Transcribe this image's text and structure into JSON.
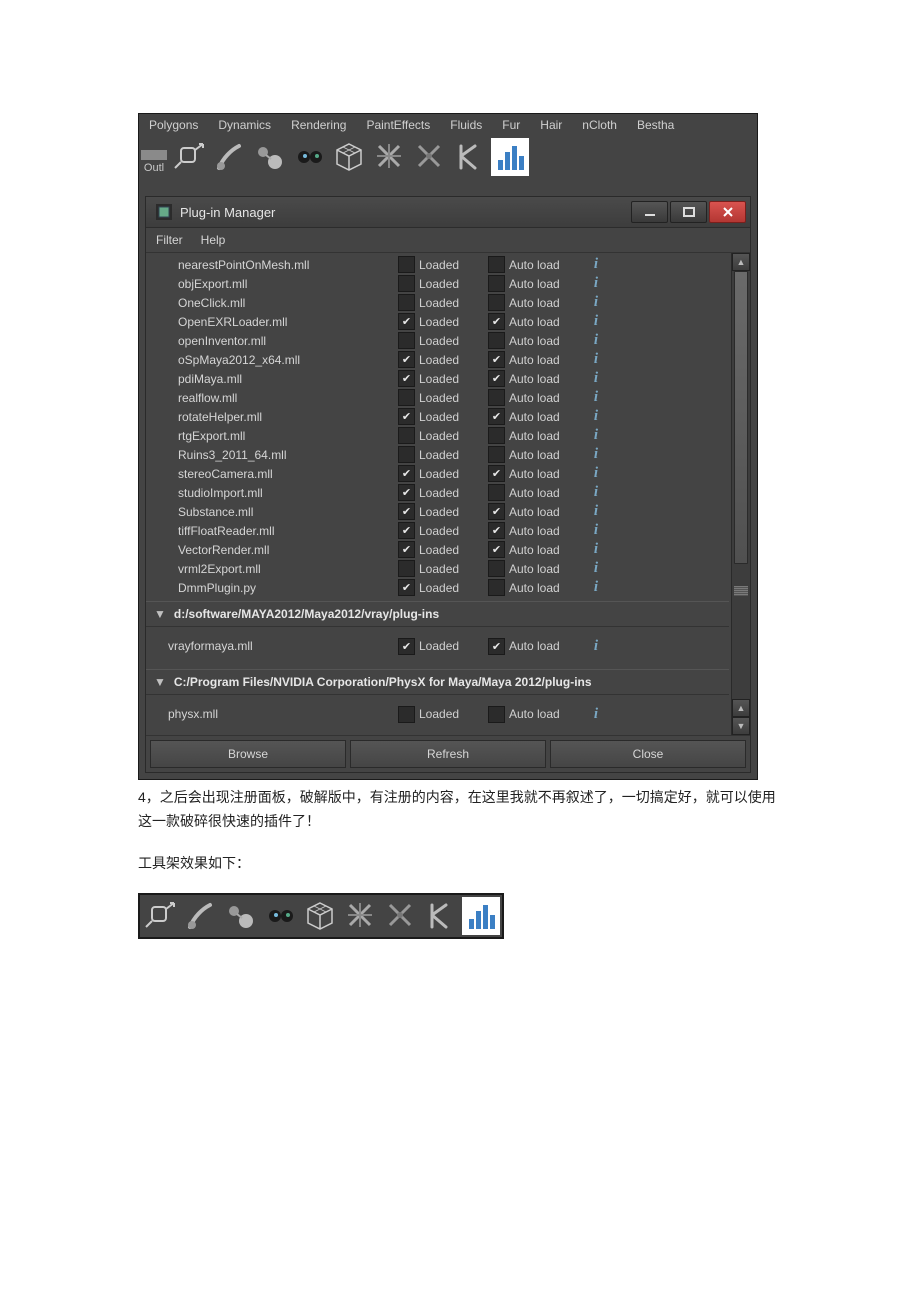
{
  "shelf_tabs": [
    "Polygons",
    "Dynamics",
    "Rendering",
    "PaintEffects",
    "Fluids",
    "Fur",
    "Hair",
    "nCloth",
    "Bestha"
  ],
  "outliner_label": "Outl",
  "window": {
    "title": "Plug-in Manager",
    "menu": {
      "filter": "Filter",
      "help": "Help"
    },
    "labels": {
      "loaded": "Loaded",
      "autoload": "Auto load"
    },
    "sections": [
      {
        "header": null,
        "plugins": [
          {
            "name": "nearestPointOnMesh.mll",
            "loaded": false,
            "autoload": false
          },
          {
            "name": "objExport.mll",
            "loaded": false,
            "autoload": false
          },
          {
            "name": "OneClick.mll",
            "loaded": false,
            "autoload": false
          },
          {
            "name": "OpenEXRLoader.mll",
            "loaded": true,
            "autoload": true
          },
          {
            "name": "openInventor.mll",
            "loaded": false,
            "autoload": false
          },
          {
            "name": "oSpMaya2012_x64.mll",
            "loaded": true,
            "autoload": true
          },
          {
            "name": "pdiMaya.mll",
            "loaded": true,
            "autoload": true
          },
          {
            "name": "realflow.mll",
            "loaded": false,
            "autoload": false
          },
          {
            "name": "rotateHelper.mll",
            "loaded": true,
            "autoload": true
          },
          {
            "name": "rtgExport.mll",
            "loaded": false,
            "autoload": false
          },
          {
            "name": "Ruins3_2011_64.mll",
            "loaded": false,
            "autoload": false
          },
          {
            "name": "stereoCamera.mll",
            "loaded": true,
            "autoload": true
          },
          {
            "name": "studioImport.mll",
            "loaded": true,
            "autoload": false
          },
          {
            "name": "Substance.mll",
            "loaded": true,
            "autoload": true
          },
          {
            "name": "tiffFloatReader.mll",
            "loaded": true,
            "autoload": true
          },
          {
            "name": "VectorRender.mll",
            "loaded": true,
            "autoload": true
          },
          {
            "name": "vrml2Export.mll",
            "loaded": false,
            "autoload": false
          },
          {
            "name": "DmmPlugin.py",
            "loaded": true,
            "autoload": false
          }
        ]
      },
      {
        "header": "d:/software/MAYA2012/Maya2012/vray/plug-ins",
        "plugins": [
          {
            "name": "vrayformaya.mll",
            "loaded": true,
            "autoload": true
          }
        ]
      },
      {
        "header": "C:/Program Files/NVIDIA Corporation/PhysX for Maya/Maya 2012/plug-ins",
        "plugins": [
          {
            "name": "physx.mll",
            "loaded": false,
            "autoload": false
          }
        ]
      }
    ],
    "buttons": {
      "browse": "Browse",
      "refresh": "Refresh",
      "close": "Close"
    }
  },
  "article": {
    "p1": "4，之后会出现注册面板，破解版中，有注册的内容，在这里我就不再叙述了，一切搞定好，就可以使用这一款破碎很快速的插件了！",
    "p2": "工具架效果如下："
  },
  "icons": {
    "tool1": "transform-icon",
    "tool2": "brush-icon",
    "tool3": "balls-icon",
    "tool4": "eyes-icon",
    "tool5": "wireframe-cube-icon",
    "tool6": "cross-a-icon",
    "tool7": "cross-b-icon",
    "tool8": "k-icon",
    "tool9": "bars-icon"
  }
}
